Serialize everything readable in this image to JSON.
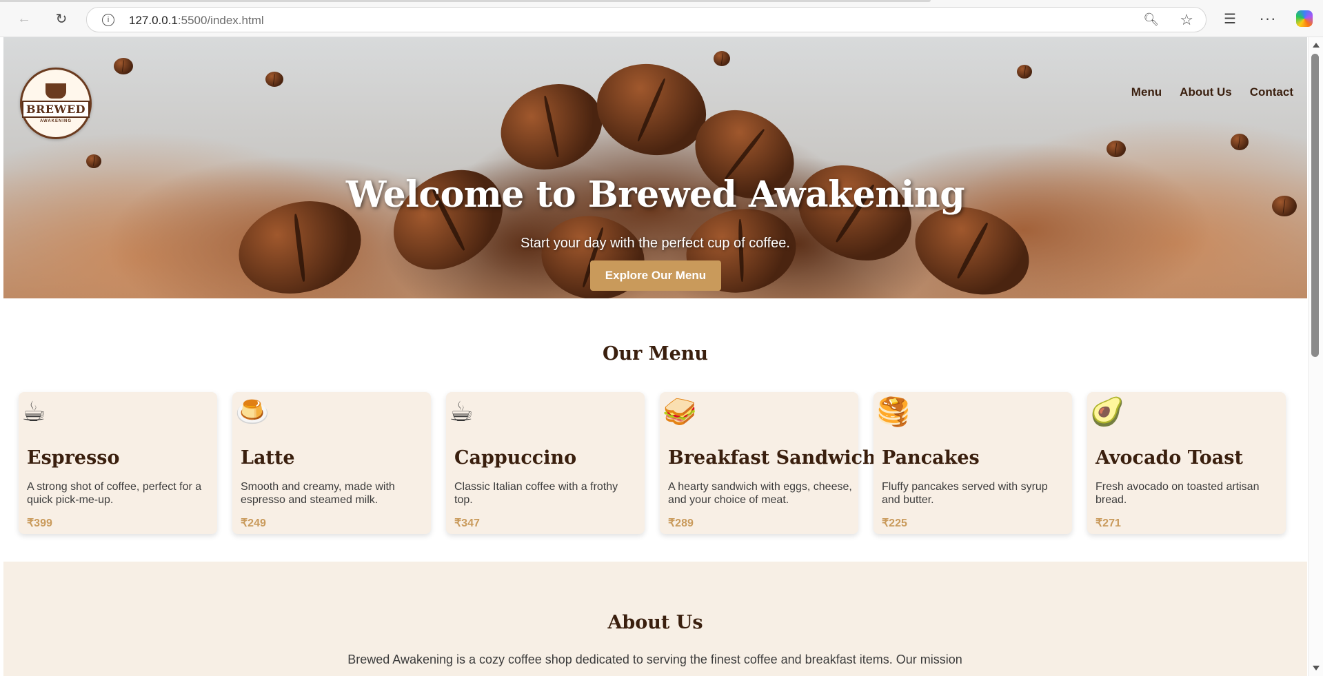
{
  "browser": {
    "url_host": "127.0.0.1",
    "url_path": ":5500/index.html"
  },
  "header": {
    "nav": [
      "Menu",
      "About Us",
      "Contact"
    ],
    "logo_text": "BREWED",
    "logo_sub": "AWAKENING"
  },
  "hero": {
    "title": "Welcome to Brewed Awakening",
    "subtitle": "Start your day with the perfect cup of coffee.",
    "cta": "Explore Our Menu"
  },
  "menu": {
    "title": "Our Menu",
    "items": [
      {
        "icon": "☕",
        "name": "Espresso",
        "desc": "A strong shot of coffee, perfect for a quick pick-me-up.",
        "price": "₹399"
      },
      {
        "icon": "🍮",
        "name": "Latte",
        "desc": "Smooth and creamy, made with espresso and steamed milk.",
        "price": "₹249"
      },
      {
        "icon": "☕",
        "name": "Cappuccino",
        "desc": "Classic Italian coffee with a frothy top.",
        "price": "₹347"
      },
      {
        "icon": "🥪",
        "name": "Breakfast Sandwich",
        "desc": "A hearty sandwich with eggs, cheese, and your choice of meat.",
        "price": "₹289"
      },
      {
        "icon": "🥞",
        "name": "Pancakes",
        "desc": "Fluffy pancakes served with syrup and butter.",
        "price": "₹225"
      },
      {
        "icon": "🥑",
        "name": "Avocado Toast",
        "desc": "Fresh avocado on toasted artisan bread.",
        "price": "₹271"
      }
    ]
  },
  "about": {
    "title": "About Us",
    "text": "Brewed Awakening is a cozy coffee shop dedicated to serving the finest coffee and breakfast items. Our mission"
  }
}
